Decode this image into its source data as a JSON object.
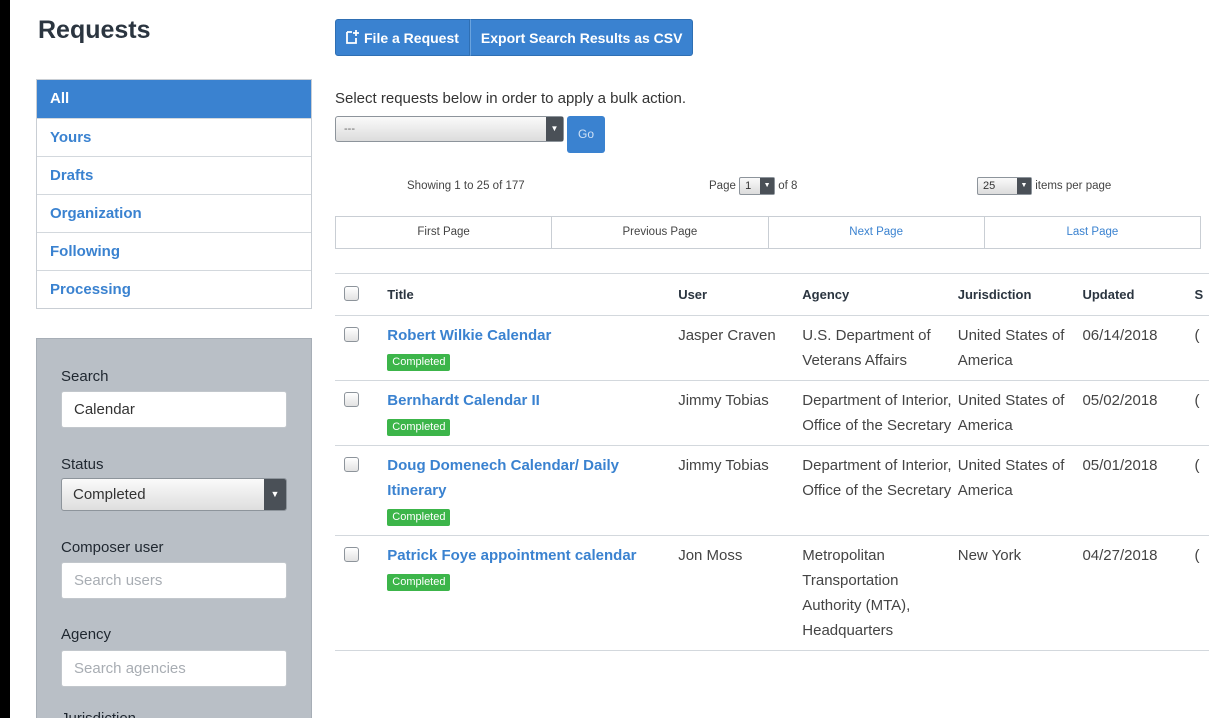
{
  "sidebar": {
    "title": "Requests",
    "nav": [
      "All",
      "Yours",
      "Drafts",
      "Organization",
      "Following",
      "Processing"
    ],
    "filters": {
      "search_label": "Search",
      "search_value": "Calendar",
      "status_label": "Status",
      "status_value": "Completed",
      "composer_label": "Composer user",
      "composer_placeholder": "Search users",
      "agency_label": "Agency",
      "agency_placeholder": "Search agencies",
      "jurisdiction_label": "Jurisdiction"
    }
  },
  "toolbar": {
    "file_request": "File a Request",
    "export": "Export Search Results as CSV"
  },
  "bulk": {
    "instruction": "Select requests below in order to apply a bulk action.",
    "select_value": "---",
    "go": "Go"
  },
  "pagination": {
    "showing": "Showing 1 to 25 of 177",
    "page_label": "Page",
    "page_value": "1",
    "of_label": "of 8",
    "per_page_value": "25",
    "per_page_label": "items per page",
    "first": "First Page",
    "previous": "Previous Page",
    "next": "Next Page",
    "last": "Last Page"
  },
  "table": {
    "headers": {
      "title": "Title",
      "user": "User",
      "agency": "Agency",
      "jurisdiction": "Jurisdiction",
      "updated": "Updated",
      "extra": "S"
    },
    "rows": [
      {
        "title": "Robert Wilkie Calendar",
        "status": "Completed",
        "user": "Jasper Craven",
        "agency": "U.S. Department of Veterans Affairs",
        "jurisdiction": "United States of America",
        "updated": "06/14/2018",
        "extra": "("
      },
      {
        "title": "Bernhardt Calendar II",
        "status": "Completed",
        "user": "Jimmy Tobias",
        "agency": "Department of Interior, Office of the Secretary",
        "jurisdiction": "United States of America",
        "updated": "05/02/2018",
        "extra": "("
      },
      {
        "title": "Doug Domenech Calendar/ Daily Itinerary",
        "status": "Completed",
        "user": "Jimmy Tobias",
        "agency": "Department of Interior, Office of the Secretary",
        "jurisdiction": "United States of America",
        "updated": "05/01/2018",
        "extra": "("
      },
      {
        "title": "Patrick Foye appointment calendar",
        "status": "Completed",
        "user": "Jon Moss",
        "agency": "Metropolitan Transportation Authority (MTA), Headquarters",
        "jurisdiction": "New York",
        "updated": "04/27/2018",
        "extra": "("
      }
    ]
  },
  "colors": {
    "accent": "#3a82d0",
    "completed": "#3cb54a",
    "panel": "#b9bfc6"
  }
}
